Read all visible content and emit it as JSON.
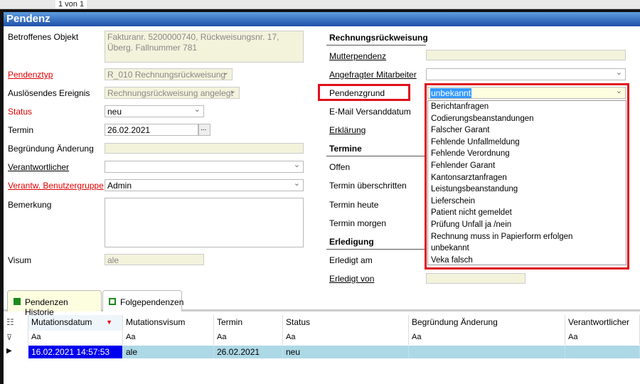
{
  "toolbar": {
    "pager": "1 von 1"
  },
  "header": {
    "title": "Pendenz"
  },
  "left": {
    "betroffenes_label": "Betroffenes Objekt",
    "betroffenes_value": "Fakturanr. 5200000740, Rückweisungsnr. 17, Überg. Fallnummer 781",
    "pendenztyp_label": "Pendenztyp",
    "pendenztyp_value": "R_010 Rechnungsrückweisung",
    "ereignis_label": "Auslösendes Ereignis",
    "ereignis_value": "Rechnungsrückweisung angelegt",
    "status_label": "Status",
    "status_value": "neu",
    "termin_label": "Termin",
    "termin_value": "26.02.2021",
    "termin_btn": "...",
    "begruendung_label": "Begründung Änderung",
    "begruendung_value": "",
    "verantwortlicher_label": "Verantwortlicher",
    "verantwortlicher_value": "",
    "gruppe_label": "Verantw. Benutzergruppe",
    "gruppe_value": "Admin",
    "bemerkung_label": "Bemerkung",
    "bemerkung_value": "",
    "visum_label": "Visum",
    "visum_value": "ale"
  },
  "right": {
    "section1": "Rechnungsrückweisung",
    "mutter_label": "Mutterpendenz",
    "mitarbeiter_label": "Angefragter Mitarbeiter",
    "grund_label": "Pendenzgrund",
    "grund_value": "unbekannt",
    "email_label": "E-Mail Versanddatum",
    "erklaerung_label": "Erklärung",
    "section2": "Termine",
    "offen_label": "Offen",
    "ueberschritten_label": "Termin überschritten",
    "heute_label": "Termin heute",
    "morgen_label": "Termin morgen",
    "section3": "Erledigung",
    "erledigt_am_label": "Erledigt am",
    "erledigt_von_label": "Erledigt von"
  },
  "dropdown": {
    "options": [
      "Berichtanfragen",
      "Codierungsbeanstandungen",
      "Falscher Garant",
      "Fehlende Unfallmeldung",
      "Fehlende Verordnung",
      "Fehlender Garant",
      "Kantonsarztanfragen",
      "Leistungsbeanstandung",
      "Lieferschein",
      "Patient nicht gemeldet",
      "Prüfung Unfall ja /nein",
      "Rechnung muss in Papierform erfolgen",
      "unbekannt",
      "Veka falsch"
    ]
  },
  "tabs": [
    {
      "label": "Pendenzen Historie"
    },
    {
      "label": "Folgependenzen"
    }
  ],
  "grid": {
    "columns": [
      "Mutationsdatum",
      "Mutationsvisum",
      "Termin",
      "Status",
      "Begründung Änderung",
      "Verantwortlicher"
    ],
    "filter": "Aa",
    "rows": [
      [
        "16.02.2021 14:57:53",
        "ale",
        "26.02.2021",
        "neu",
        "",
        ""
      ]
    ]
  },
  "colors": {
    "header": "#1f4fa8",
    "highlight": "#e0101a",
    "row": "#add8e6"
  }
}
